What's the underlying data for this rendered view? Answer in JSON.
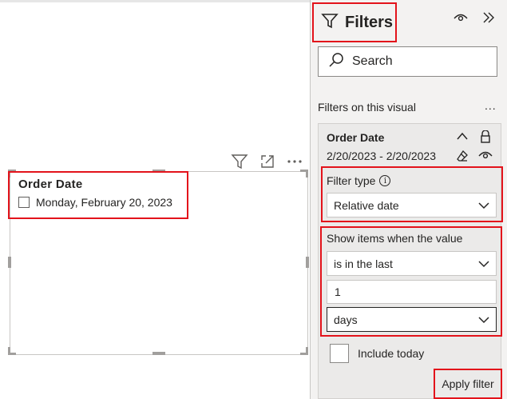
{
  "visual": {
    "title": "Order Date",
    "item_label": "Monday, February 20, 2023",
    "icons": [
      "filter-icon",
      "focus-mode-icon",
      "more-options-icon"
    ]
  },
  "pane": {
    "title": "Filters",
    "search_placeholder": "Search",
    "section_label": "Filters on this visual",
    "more_label": "...",
    "card": {
      "title": "Order Date",
      "summary": "2/20/2023 - 2/20/2023",
      "filter_type_label": "Filter type",
      "filter_type_value": "Relative date",
      "show_items_label": "Show items when the value",
      "operator_value": "is in the last",
      "amount_value": "1",
      "unit_value": "days",
      "include_today_label": "Include today",
      "apply_label": "Apply filter"
    }
  },
  "colors": {
    "highlight": "#e3131b",
    "pane_bg": "#f3f2f1",
    "card_bg": "#ebeae9"
  }
}
